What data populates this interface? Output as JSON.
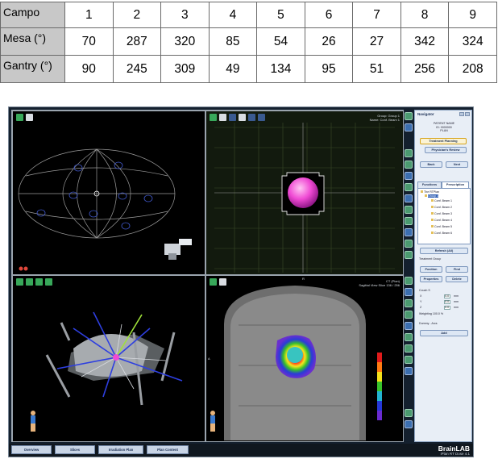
{
  "table": {
    "rows": [
      {
        "label": "Campo",
        "values": [
          "1",
          "2",
          "3",
          "4",
          "5",
          "6",
          "7",
          "8",
          "9"
        ]
      },
      {
        "label": "Mesa (°)",
        "values": [
          "70",
          "287",
          "320",
          "85",
          "54",
          "26",
          "27",
          "342",
          "324"
        ]
      },
      {
        "label": "Gantry (°)",
        "values": [
          "90",
          "245",
          "309",
          "49",
          "134",
          "95",
          "51",
          "256",
          "208"
        ]
      }
    ]
  },
  "app": {
    "views": {
      "top_right_info": [
        "Group:",
        "Group 1",
        "Name:",
        "Conf. Beam 1"
      ],
      "ct_info": [
        "CT (Plan)",
        "Sagittal View Slice 136 / 256"
      ],
      "ct_marker": "R",
      "ct_side_marker": "A"
    },
    "navigator": {
      "title": "Navigator",
      "info": [
        "PATIENT NAME",
        "ID: 0000000",
        "PLAN"
      ],
      "buttons": {
        "treatment_planning": "Treatment Planning",
        "physicians_review": "Physician's Review",
        "back": "Back",
        "next": "Next"
      },
      "tabs": [
        "Functions",
        "Prescription"
      ],
      "tree": {
        "root": "The RTPlan",
        "group": "Group 1",
        "items": [
          "Conf. Beam 1",
          "Conf. Beam 2",
          "Conf. Beam 3",
          "Conf. Beam 4",
          "Conf. Beam 5",
          "Conf. Beam 6"
        ]
      },
      "refresh": "Refresh (All)",
      "treatment_group": "Treatment Group",
      "actions": [
        "Position",
        "Find",
        "Properties",
        "Delete"
      ],
      "couch_label": "Couch S",
      "coords": [
        {
          "axis": "X",
          "value": "0.0",
          "unit": "mm"
        },
        {
          "axis": "Y",
          "value": "0.0",
          "unit": "mm"
        },
        {
          "axis": "Z",
          "value": "0.0",
          "unit": "mm"
        }
      ],
      "weighting_label": "Weighting",
      "weighting_value": "100.0 %",
      "dummy_label": "Dummy - Arcs",
      "add": "Add"
    },
    "bottom_tabs": [
      "Overview",
      "Slices",
      "Irradiation Plan",
      "Plan Content"
    ],
    "brand": "BrainLAB",
    "brand_sub": "iPlan RT Dose 4.1"
  }
}
